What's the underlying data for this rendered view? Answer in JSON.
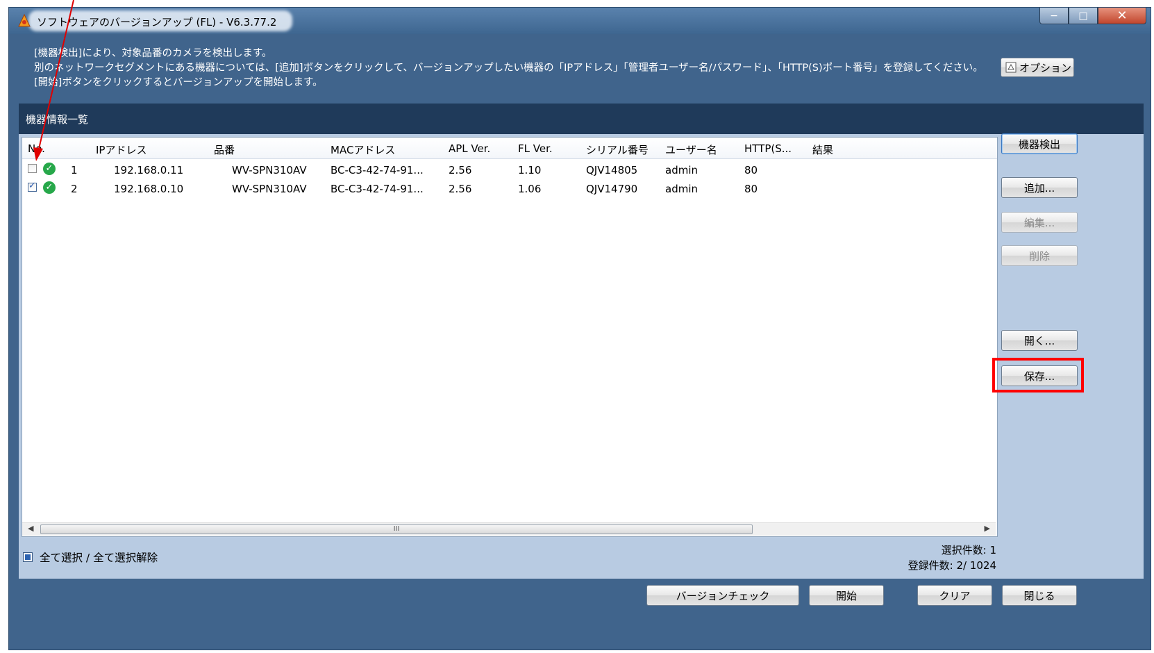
{
  "window": {
    "title": "ソフトウェアのバージョンアップ (FL) - V6.3.77.2",
    "controls": {
      "minimize": "−",
      "maximize": "□",
      "close": "✕"
    }
  },
  "description": {
    "line1": "[機器検出]により、対象品番のカメラを検出します。",
    "line2": "別のネットワークセグメントにある機器については、[追加]ボタンをクリックして、バージョンアップしたい機器の「IPアドレス」「管理者ユーザー名/パスワード」、「HTTP(S)ポート番号」を登録してください。",
    "line3": "[開始]ボタンをクリックするとバージョンアップを開始します。"
  },
  "option_button": "オプション",
  "section_title": "機器情報一覧",
  "table": {
    "headers": [
      "No.",
      "IPアドレス",
      "品番",
      "MACアドレス",
      "APL Ver.",
      "FL Ver.",
      "シリアル番号",
      "ユーザー名",
      "HTTP(S...",
      "結果"
    ],
    "rows": [
      {
        "checked": false,
        "status": "ok",
        "no": "1",
        "ip": "192.168.0.11",
        "model": "WV-SPN310AV",
        "mac": "BC-C3-42-74-91...",
        "apl": "2.56",
        "fl": "1.10",
        "serial": "QJV14805",
        "user": "admin",
        "http": "80",
        "result": ""
      },
      {
        "checked": true,
        "status": "ok",
        "no": "2",
        "ip": "192.168.0.10",
        "model": "WV-SPN310AV",
        "mac": "BC-C3-42-74-91...",
        "apl": "2.56",
        "fl": "1.06",
        "serial": "QJV14790",
        "user": "admin",
        "http": "80",
        "result": ""
      }
    ],
    "scroll_grip": "III"
  },
  "side_buttons": {
    "detect": "機器検出",
    "add": "追加...",
    "edit": "編集...",
    "delete": "削除",
    "open": "開く...",
    "save": "保存..."
  },
  "select_all": "全て選択 / 全て選択解除",
  "counts": {
    "selected": "選択件数: 1",
    "registered": "登録件数:  2/ 1024"
  },
  "bottom_buttons": {
    "version_check": "バージョンチェック",
    "start": "開始",
    "clear": "クリア",
    "close": "閉じる"
  },
  "colors": {
    "window_bg": "#40648c",
    "section_bar": "#1f3a5a",
    "panel_bg": "#b8cbe2",
    "highlight": "#ff0000",
    "ok_icon": "#27a84a"
  }
}
